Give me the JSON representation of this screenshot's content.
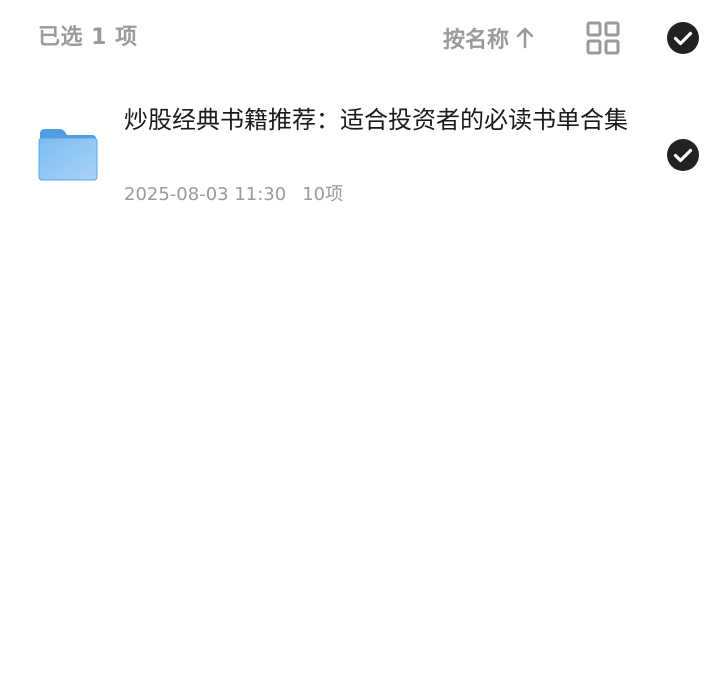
{
  "toolbar": {
    "selected_text": "已选 1 项",
    "sort_label": "按名称",
    "sort_icon": "arrow-up-icon",
    "view_icon": "grid-view-icon",
    "select_all_icon": "check-circle-icon"
  },
  "files": [
    {
      "name": "炒股经典书籍推荐：适合投资者的必读书单合集",
      "date": "2025-08-03 11:30",
      "count": "10项",
      "icon": "folder-icon",
      "selected": true
    }
  ],
  "colors": {
    "text_primary": "#1a1a1a",
    "text_secondary": "#9a9a9a",
    "check_fill": "#222222",
    "folder_blue": "#6fb2ee"
  }
}
